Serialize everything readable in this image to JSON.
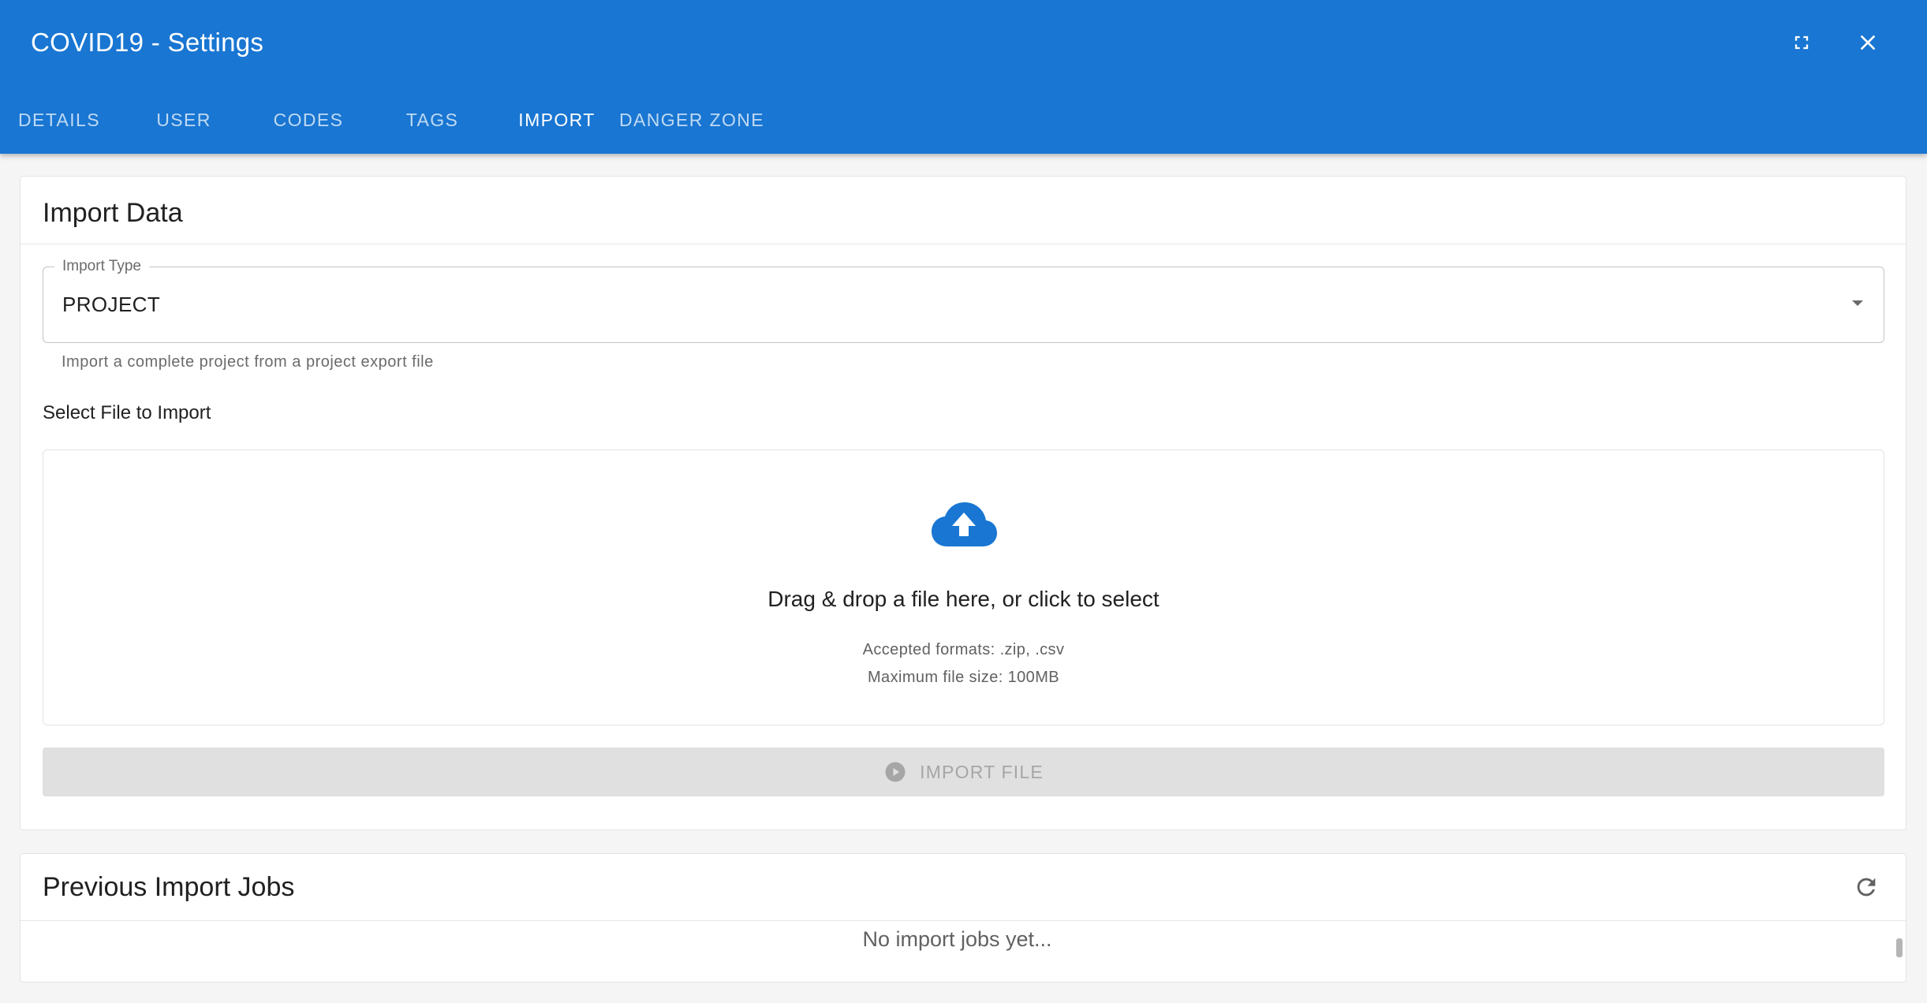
{
  "header": {
    "title": "COVID19 - Settings",
    "fullscreen_icon": "fullscreen-icon",
    "close_icon": "close-icon",
    "background_color": "#1976d2"
  },
  "tabs": [
    {
      "label": "DETAILS",
      "active": false
    },
    {
      "label": "USER",
      "active": false
    },
    {
      "label": "CODES",
      "active": false
    },
    {
      "label": "TAGS",
      "active": false
    },
    {
      "label": "IMPORT",
      "active": true
    },
    {
      "label": "DANGER ZONE",
      "active": false
    }
  ],
  "import_card": {
    "title": "Import Data",
    "import_type": {
      "label": "Import Type",
      "value": "PROJECT",
      "helper": "Import a complete project from a project export file"
    },
    "file_section_label": "Select File to Import",
    "dropzone": {
      "icon": "cloud-upload-icon",
      "main_text": "Drag & drop a file here, or click to select",
      "formats": "Accepted formats: .zip, .csv",
      "max_size": "Maximum file size: 100MB"
    },
    "import_button": {
      "label": "IMPORT FILE",
      "icon": "play-circle-icon",
      "disabled": true
    }
  },
  "jobs_card": {
    "title": "Previous Import Jobs",
    "refresh_icon": "refresh-icon",
    "empty_text": "No import jobs yet..."
  },
  "colors": {
    "primary": "#1976d2",
    "background": "#f5f5f5",
    "disabled_button": "#e0e0e0"
  }
}
